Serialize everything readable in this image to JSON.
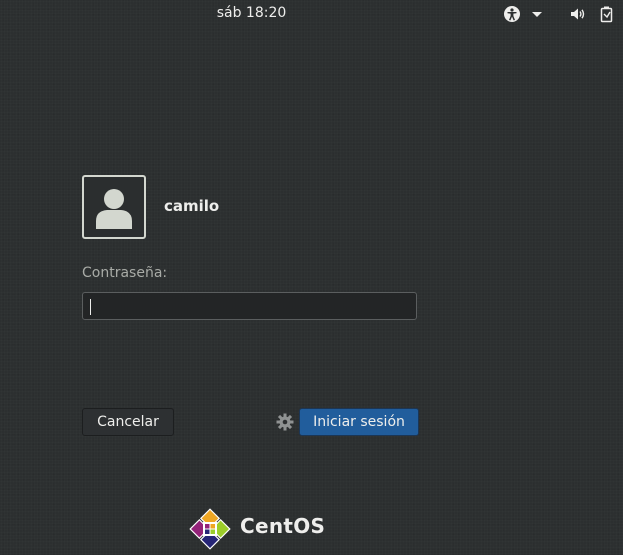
{
  "top_bar": {
    "clock": "sáb 18:20",
    "icons": [
      "accessibility-icon",
      "chevron-down-icon",
      "volume-icon",
      "battery-icon"
    ]
  },
  "login": {
    "username": "camilo",
    "password_label": "Contraseña:",
    "password_value": "",
    "cancel_label": "Cancelar",
    "signin_label": "Iniciar sesión",
    "settings_icon": "gear-icon"
  },
  "branding": {
    "logo_text": "CentOS"
  },
  "colors": {
    "background": "#2c2f30",
    "accent": "#215d9c"
  }
}
